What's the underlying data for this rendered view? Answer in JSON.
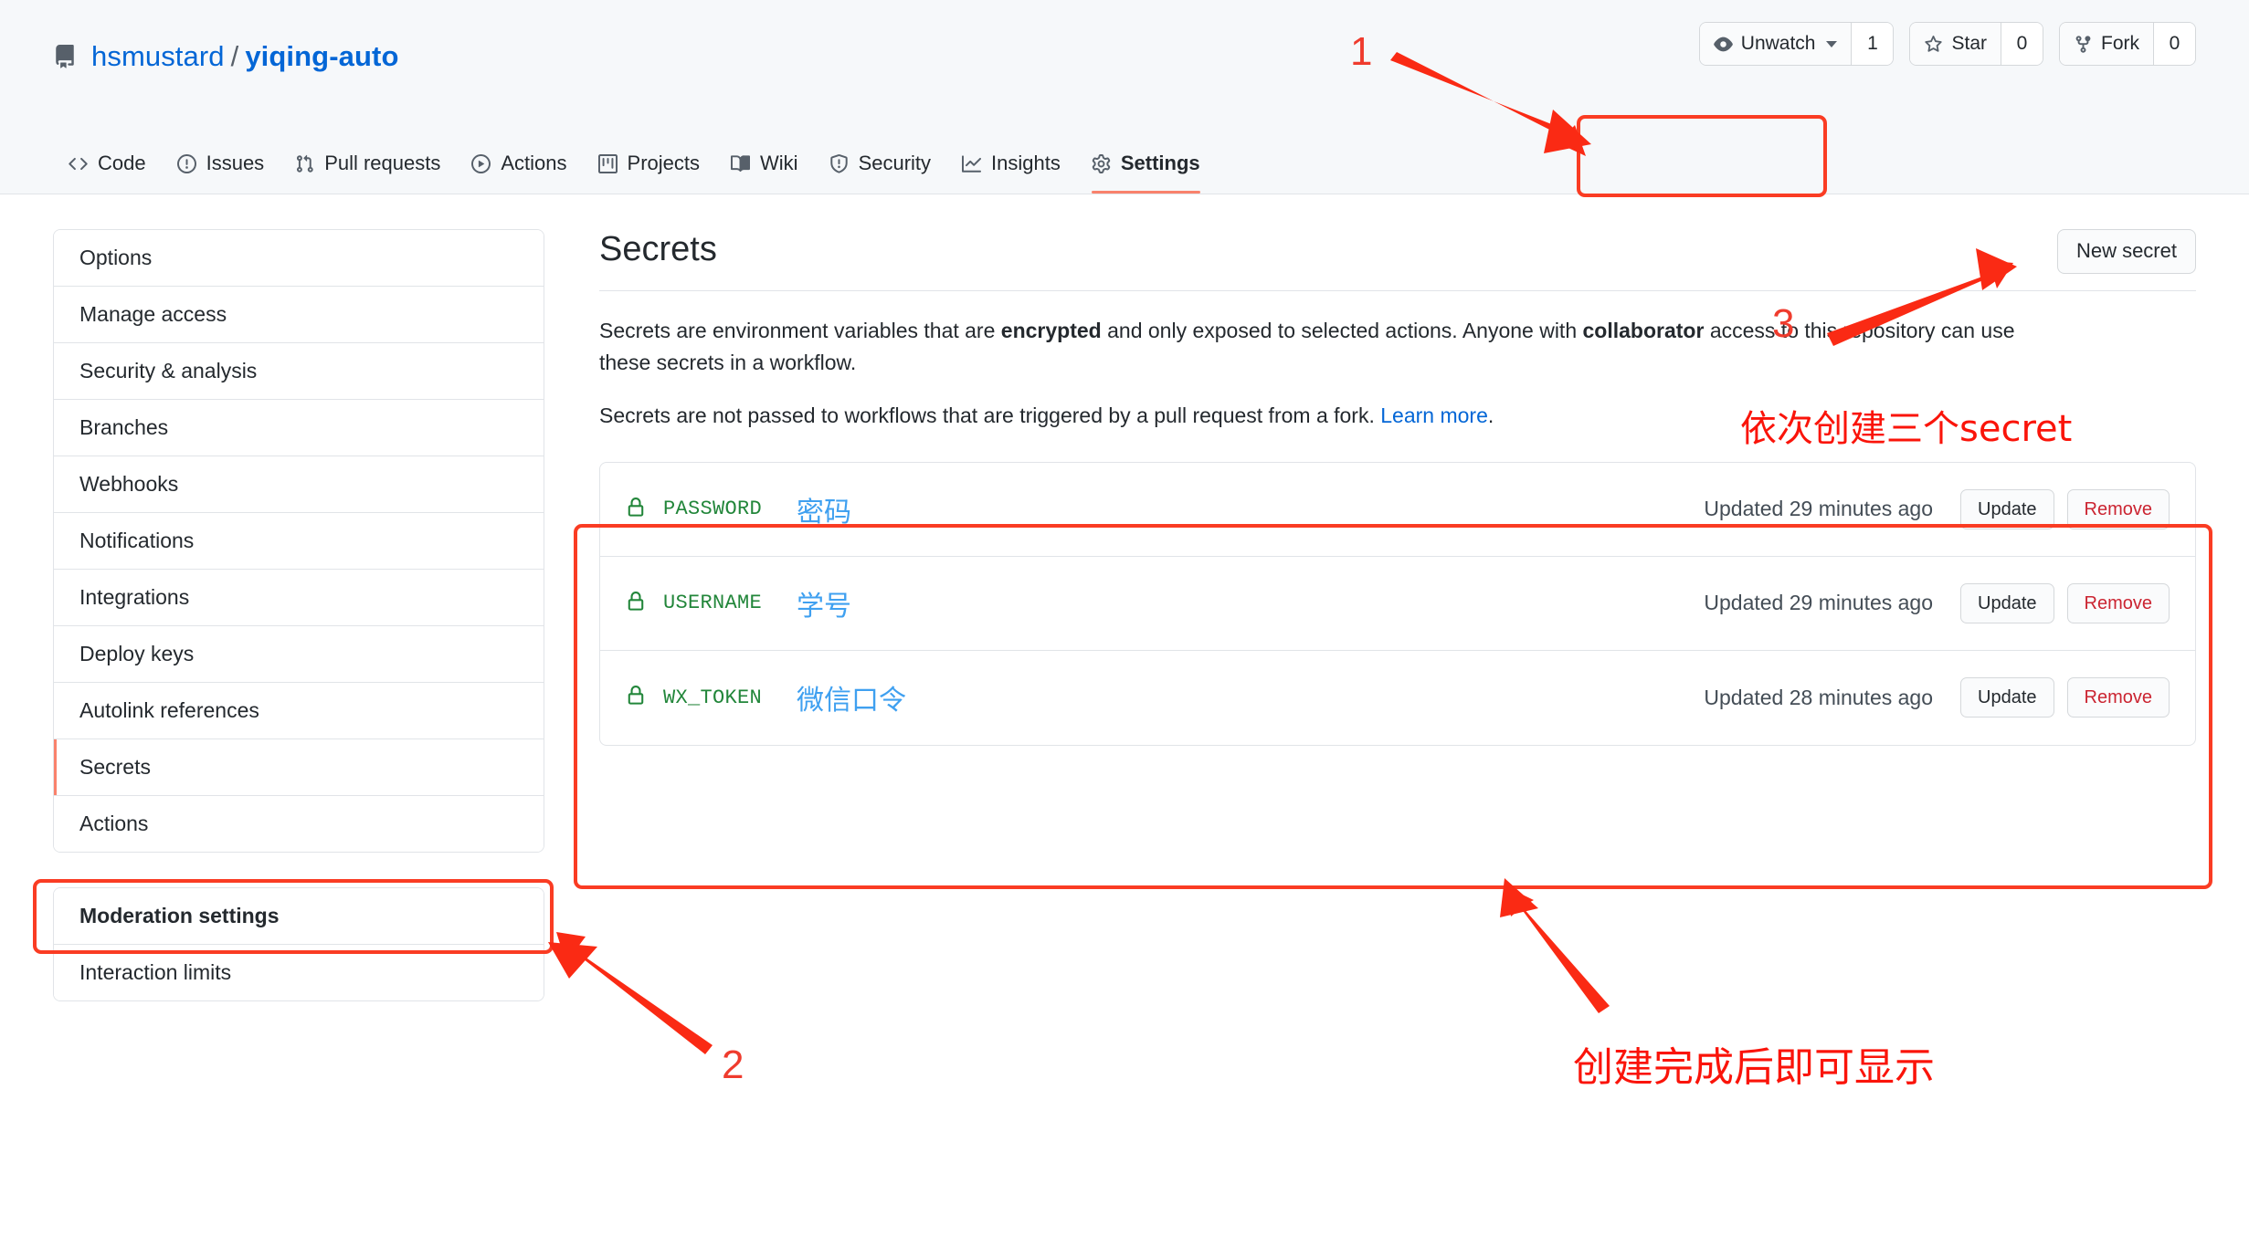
{
  "repo": {
    "owner": "hsmustard",
    "separator": "/",
    "name": "yiqing-auto",
    "icon": "repo-icon"
  },
  "repo_actions": [
    {
      "label": "Unwatch",
      "count": "1",
      "icon": "eye-icon",
      "has_caret": true
    },
    {
      "label": "Star",
      "count": "0",
      "icon": "star-icon",
      "has_caret": false
    },
    {
      "label": "Fork",
      "count": "0",
      "icon": "fork-icon",
      "has_caret": false
    }
  ],
  "nav": {
    "items": [
      {
        "label": "Code",
        "icon": "code-icon",
        "selected": false
      },
      {
        "label": "Issues",
        "icon": "issue-opened-icon",
        "selected": false
      },
      {
        "label": "Pull requests",
        "icon": "git-pull-request-icon",
        "selected": false
      },
      {
        "label": "Actions",
        "icon": "play-icon",
        "selected": false
      },
      {
        "label": "Projects",
        "icon": "project-icon",
        "selected": false
      },
      {
        "label": "Wiki",
        "icon": "book-icon",
        "selected": false
      },
      {
        "label": "Security",
        "icon": "shield-icon",
        "selected": false
      },
      {
        "label": "Insights",
        "icon": "graph-icon",
        "selected": false
      },
      {
        "label": "Settings",
        "icon": "gear-icon",
        "selected": true
      }
    ]
  },
  "sidebar": {
    "groups": [
      {
        "items": [
          {
            "label": "Options",
            "selected": false,
            "heading": false
          },
          {
            "label": "Manage access",
            "selected": false,
            "heading": false
          },
          {
            "label": "Security & analysis",
            "selected": false,
            "heading": false
          },
          {
            "label": "Branches",
            "selected": false,
            "heading": false
          },
          {
            "label": "Webhooks",
            "selected": false,
            "heading": false
          },
          {
            "label": "Notifications",
            "selected": false,
            "heading": false
          },
          {
            "label": "Integrations",
            "selected": false,
            "heading": false
          },
          {
            "label": "Deploy keys",
            "selected": false,
            "heading": false
          },
          {
            "label": "Autolink references",
            "selected": false,
            "heading": false
          },
          {
            "label": "Secrets",
            "selected": true,
            "heading": false
          },
          {
            "label": "Actions",
            "selected": false,
            "heading": false
          }
        ]
      },
      {
        "items": [
          {
            "label": "Moderation settings",
            "selected": false,
            "heading": true
          },
          {
            "label": "Interaction limits",
            "selected": false,
            "heading": false
          }
        ]
      }
    ]
  },
  "main": {
    "title": "Secrets",
    "new_secret_label": "New secret",
    "description_1": {
      "part1": "Secrets are environment variables that are ",
      "bold1": "encrypted",
      "part2": " and only exposed to selected actions. Anyone with ",
      "bold2": "collaborator",
      "part3": " access to this repository can use these secrets in a workflow."
    },
    "description_2": {
      "part1": "Secrets are not passed to workflows that are triggered by a pull request from a fork. ",
      "link": "Learn more",
      "part2": "."
    },
    "secrets": [
      {
        "icon": "lock-icon",
        "name": "PASSWORD",
        "note": "密码",
        "updated": "Updated 29 minutes ago",
        "update_label": "Update",
        "remove_label": "Remove"
      },
      {
        "icon": "lock-icon",
        "name": "USERNAME",
        "note": "学号",
        "updated": "Updated 29 minutes ago",
        "update_label": "Update",
        "remove_label": "Remove"
      },
      {
        "icon": "lock-icon",
        "name": "WX_TOKEN",
        "note": "微信口令",
        "updated": "Updated 28 minutes ago",
        "update_label": "Update",
        "remove_label": "Remove"
      }
    ]
  },
  "annotations": {
    "step_1": "1",
    "step_2": "2",
    "step_3": "3",
    "note_create_three": "依次创建三个secret",
    "note_shows_after_create": "创建完成后即可显示",
    "color": "#fa3c23"
  }
}
